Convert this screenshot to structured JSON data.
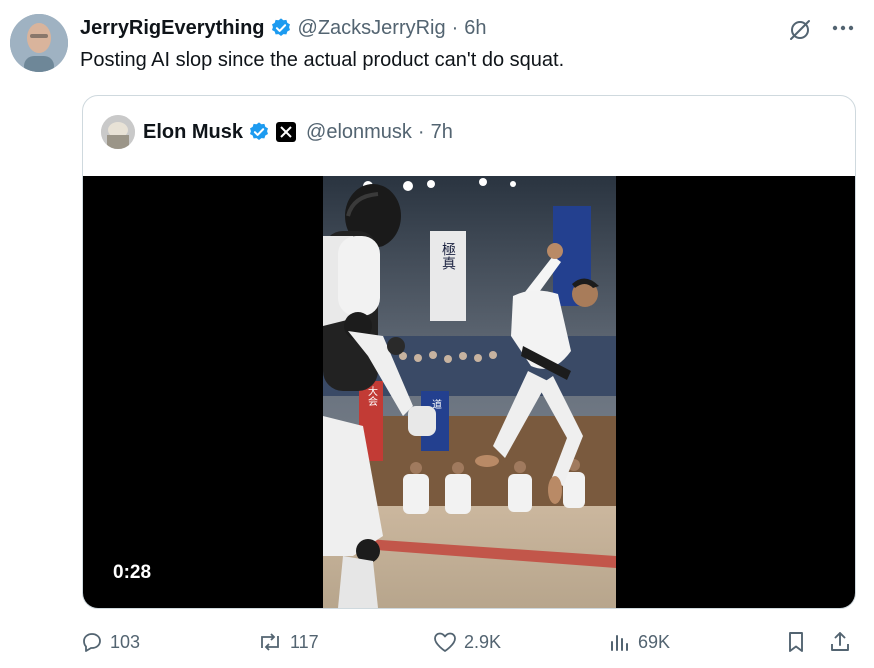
{
  "tweet": {
    "author_name": "JerryRigEverything",
    "handle": "@ZacksJerryRig",
    "time": "6h",
    "text": "Posting AI slop since the actual product can't do squat."
  },
  "quoted": {
    "author_name": "Elon Musk",
    "handle": "@elonmusk",
    "time": "7h",
    "video_duration": "0:28",
    "banner_left_text": "大会",
    "banner_center_text": "極真",
    "banner_right_text": "道"
  },
  "actions": {
    "replies": "103",
    "reposts": "117",
    "likes": "2.9K",
    "views": "69K"
  },
  "colors": {
    "verified_blue": "#1d9bf0",
    "secondary_text": "#536471",
    "border": "#cfd9de"
  },
  "icons": [
    "verified-badge-icon",
    "grok-icon",
    "more-icon",
    "x-logo-icon",
    "reply-icon",
    "repost-icon",
    "like-icon",
    "views-icon",
    "bookmark-icon",
    "share-icon"
  ]
}
